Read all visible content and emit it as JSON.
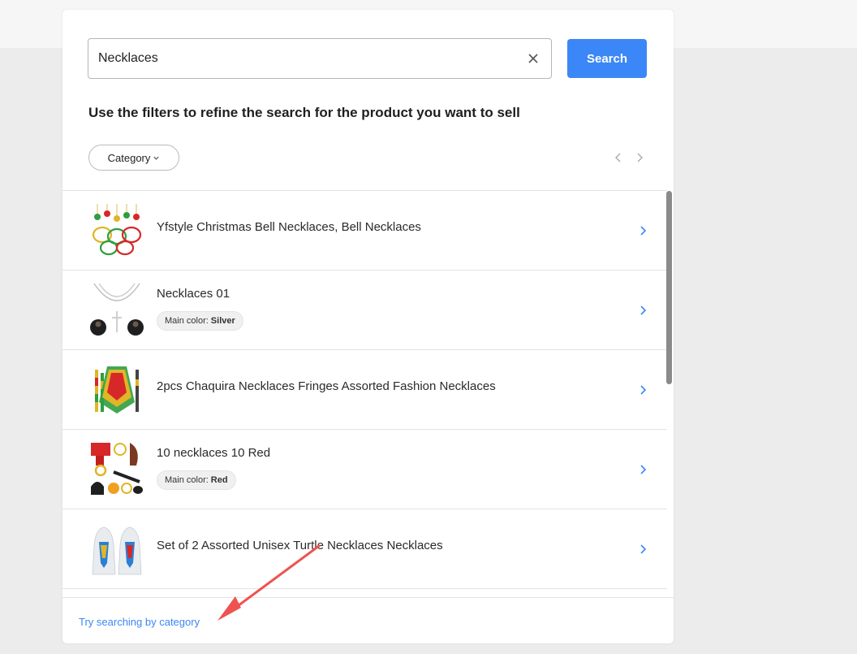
{
  "search": {
    "value": "Necklaces",
    "button_label": "Search"
  },
  "instructions": "Use the filters to refine the search for the product you want to sell",
  "filters": {
    "category_label": "Category"
  },
  "products": [
    {
      "title": "Yfstyle Christmas Bell Necklaces, Bell Necklaces"
    },
    {
      "title": "Necklaces 01",
      "badge_label": "Main color:",
      "badge_value": "Silver"
    },
    {
      "title": "2pcs Chaquira Necklaces Fringes Assorted Fashion Necklaces"
    },
    {
      "title": "10 necklaces 10 Red",
      "badge_label": "Main color:",
      "badge_value": "Red"
    },
    {
      "title": "Set of 2 Assorted Unisex Turtle Necklaces Necklaces"
    }
  ],
  "footer": {
    "link_text": "Try searching by category"
  },
  "colors": {
    "accent": "#3b87f7",
    "annotation_arrow": "#ef5350"
  }
}
